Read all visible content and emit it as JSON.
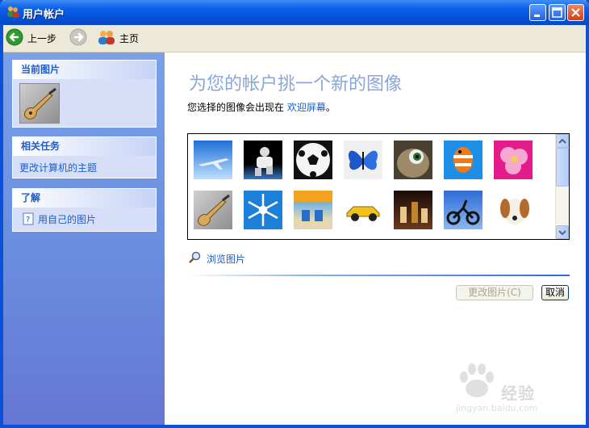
{
  "window": {
    "title": "用户帐户"
  },
  "toolbar": {
    "back_label": "上一步",
    "home_label": "主页"
  },
  "sidebar": {
    "current_picture": {
      "heading": "当前图片",
      "image": "bass-guitar"
    },
    "related_tasks": {
      "heading": "相关任务",
      "items": [
        {
          "label": "更改计算机的主题"
        }
      ]
    },
    "learn": {
      "heading": "了解",
      "items": [
        {
          "label": "用自己的图片"
        }
      ]
    }
  },
  "main": {
    "title": "为您的帐户挑一个新的图像",
    "subtitle_prefix": "您选择的图像会出现在",
    "subtitle_link": "欢迎屏幕",
    "subtitle_suffix": "。",
    "pictures": [
      "airplane",
      "astronaut",
      "soccer-ball",
      "butterfly",
      "fish-face",
      "orange-fish",
      "pink-flower",
      "bass-guitar",
      "snowflake",
      "beach-chairs",
      "race-car",
      "chess",
      "dirt-bike",
      "dog"
    ],
    "browse_label": "浏览图片",
    "change_button": "更改图片(C)",
    "cancel_button": "取消"
  },
  "watermark": {
    "text": "经验",
    "url": "jingyan.baidu.com"
  },
  "colors": {
    "accent": "#215dc6",
    "titlebar": "#0452d6",
    "sidebar": "#6a8fe0"
  }
}
